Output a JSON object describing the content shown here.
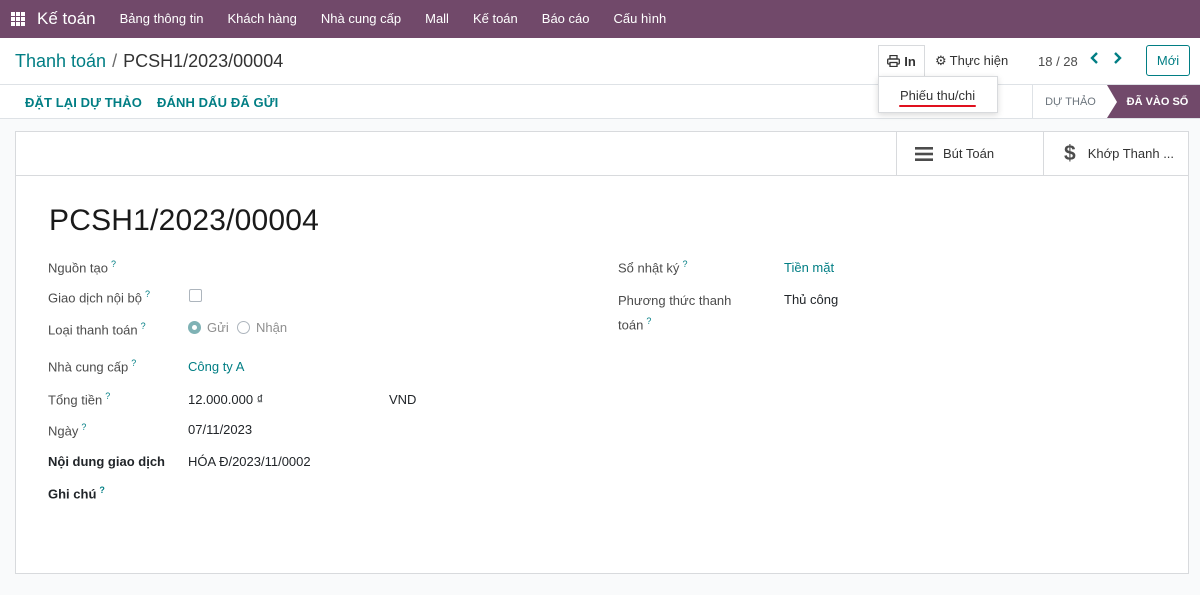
{
  "topnav": {
    "brand": "Kế toán",
    "items": [
      "Bảng thông tin",
      "Khách hàng",
      "Nhà cung cấp",
      "Mall",
      "Kế toán",
      "Báo cáo",
      "Cấu hình"
    ]
  },
  "breadcrumb": {
    "parent": "Thanh toán",
    "separator": "/",
    "current": "PCSH1/2023/00004"
  },
  "toolbar": {
    "print_label": "In",
    "action_label": "Thực hiện",
    "pager": "18 / 28",
    "new_label": "Mới"
  },
  "print_menu": {
    "items": [
      "Phiếu thu/chi"
    ]
  },
  "status_buttons": [
    "ĐẶT LẠI DỰ THẢO",
    "ĐÁNH DẤU ĐÃ GỬI"
  ],
  "statusbar": {
    "stages": [
      "DỰ THẢO",
      "ĐÃ VÀO SỔ"
    ],
    "active": "ĐÃ VÀO SỔ"
  },
  "smart_buttons": {
    "journal_entry": "Bút Toán",
    "reconcile": "Khớp Thanh ..."
  },
  "record": {
    "name": "PCSH1/2023/00004",
    "fields": {
      "source": {
        "label": "Nguồn tạo",
        "value": ""
      },
      "internal": {
        "label": "Giao dịch nội bộ",
        "checked": false
      },
      "payment_type": {
        "label": "Loại thanh toán",
        "options": [
          "Gửi",
          "Nhận"
        ],
        "selected": "Gửi"
      },
      "partner": {
        "label": "Nhà cung cấp",
        "value": "Công ty A"
      },
      "amount": {
        "label": "Tổng tiền",
        "value": "12.000.000 ₫",
        "currency": "VND"
      },
      "date": {
        "label": "Ngày",
        "value": "07/11/2023"
      },
      "memo": {
        "label": "Nội dung giao dịch",
        "value": "HÓA Đ/2023/11/0002"
      },
      "note": {
        "label": "Ghi chú",
        "value": ""
      },
      "journal": {
        "label": "Sổ nhật ký",
        "value": "Tiền mặt"
      },
      "method": {
        "label_line1": "Phương thức thanh",
        "label_line2": "toán",
        "value": "Thủ công"
      }
    },
    "help_marker": "?"
  },
  "colors": {
    "brand": "#71496a",
    "link": "#017e84",
    "highlight": "#e0101e"
  }
}
